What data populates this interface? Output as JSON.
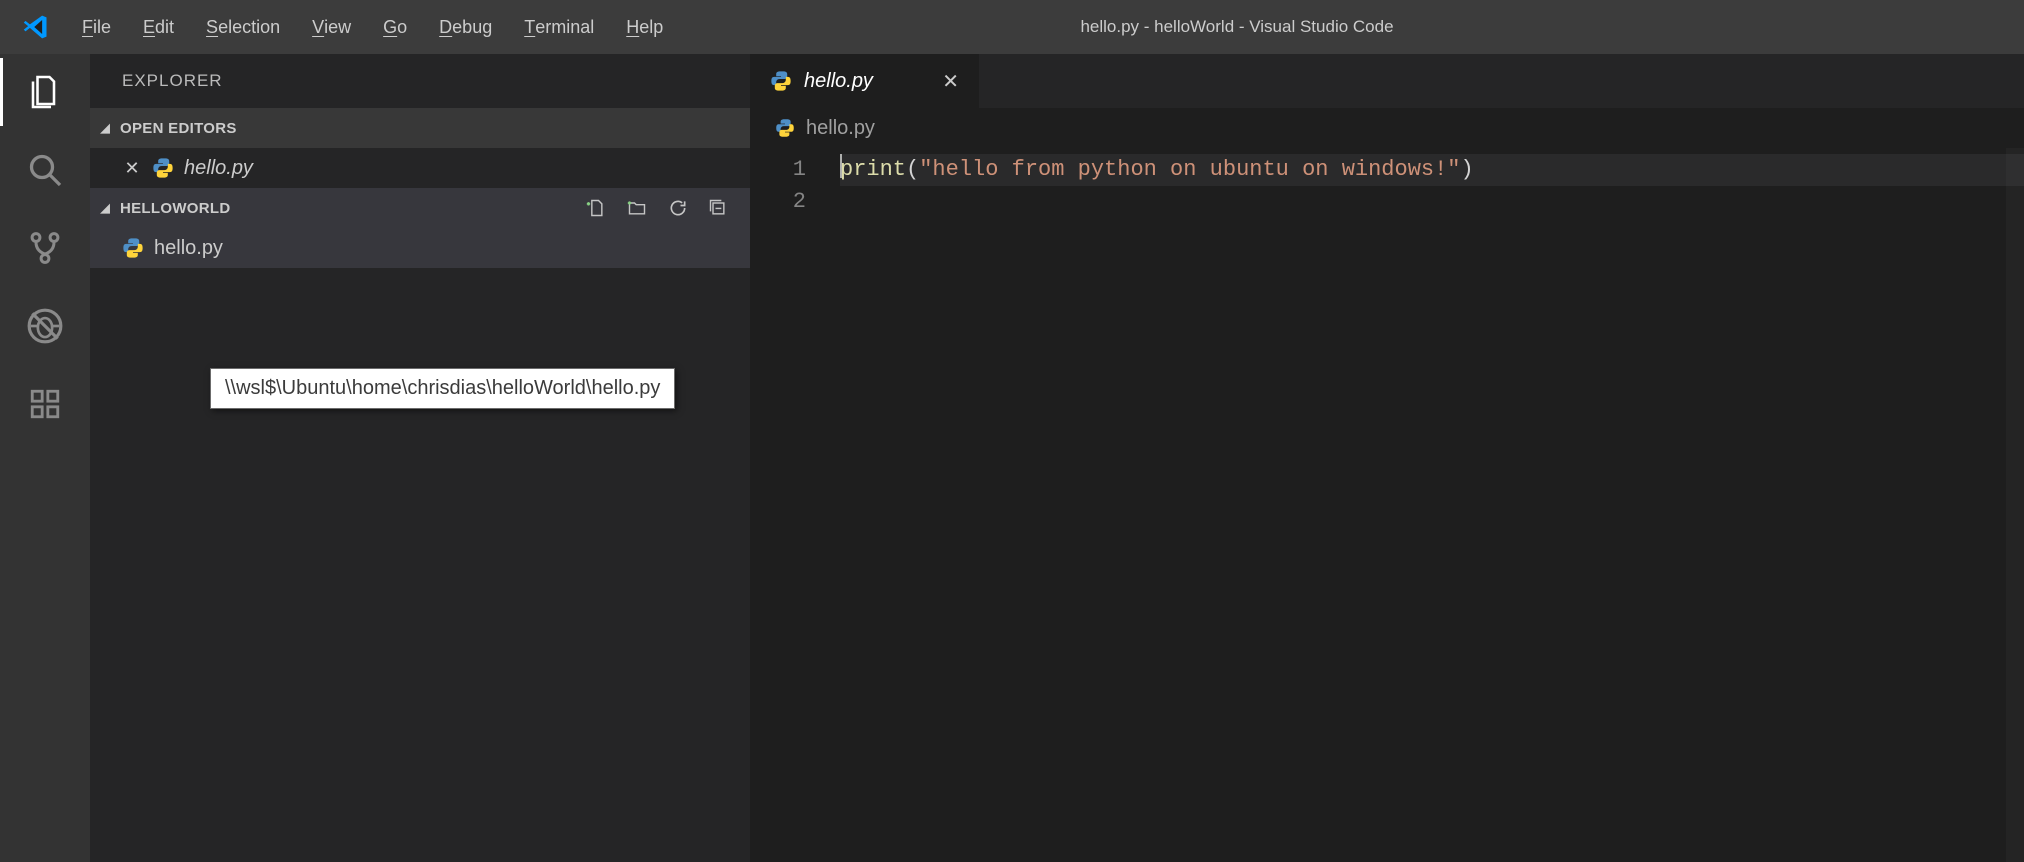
{
  "title": "hello.py - helloWorld - Visual Studio Code",
  "menu": {
    "file": {
      "mnemonic": "F",
      "rest": "ile"
    },
    "edit": {
      "mnemonic": "E",
      "rest": "dit"
    },
    "selection": {
      "mnemonic": "S",
      "rest": "election"
    },
    "view": {
      "mnemonic": "V",
      "rest": "iew"
    },
    "go": {
      "mnemonic": "G",
      "rest": "o"
    },
    "debug": {
      "mnemonic": "D",
      "rest": "ebug"
    },
    "terminal": {
      "mnemonic": "T",
      "rest": "erminal"
    },
    "help": {
      "mnemonic": "H",
      "rest": "elp"
    }
  },
  "explorer": {
    "title": "EXPLORER",
    "open_editors_label": "OPEN EDITORS",
    "folder_label": "HELLOWORLD",
    "open_file": "hello.py",
    "tree_file": "hello.py"
  },
  "editor": {
    "tab_label": "hello.py",
    "breadcrumb": "hello.py",
    "lines": {
      "l1": {
        "num": "1",
        "fn": "print",
        "open": "(",
        "str": "\"hello from python on ubuntu on windows!\"",
        "close": ")"
      },
      "l2": {
        "num": "2"
      }
    }
  },
  "tooltip": "\\\\wsl$\\Ubuntu\\home\\chrisdias\\helloWorld\\hello.py"
}
